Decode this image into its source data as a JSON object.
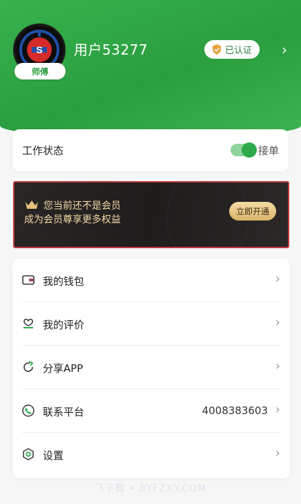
{
  "profile": {
    "username": "用户53277",
    "role_badge": "师傅",
    "verified_label": "已认证",
    "arrow": "›"
  },
  "status": {
    "label": "工作状态",
    "toggle_state": "on",
    "toggle_text": "接单"
  },
  "vip": {
    "line1": "您当前还不是会员",
    "line2": "成为会员尊享更多权益",
    "button": "立即开通"
  },
  "menu": [
    {
      "icon": "wallet-icon",
      "label": "我的钱包",
      "value": ""
    },
    {
      "icon": "rating-icon",
      "label": "我的评价",
      "value": ""
    },
    {
      "icon": "share-icon",
      "label": "分享APP",
      "value": ""
    },
    {
      "icon": "phone-icon",
      "label": "联系平台",
      "value": "4008383603"
    },
    {
      "icon": "settings-icon",
      "label": "设置",
      "value": ""
    }
  ],
  "watermark": "飞下载 • BYFZXY.COM",
  "colors": {
    "header_green": "#34a94a",
    "accent_green": "#2eaa4a",
    "vip_gold": "#f1d9a6",
    "vip_bg": "#211e1e"
  }
}
